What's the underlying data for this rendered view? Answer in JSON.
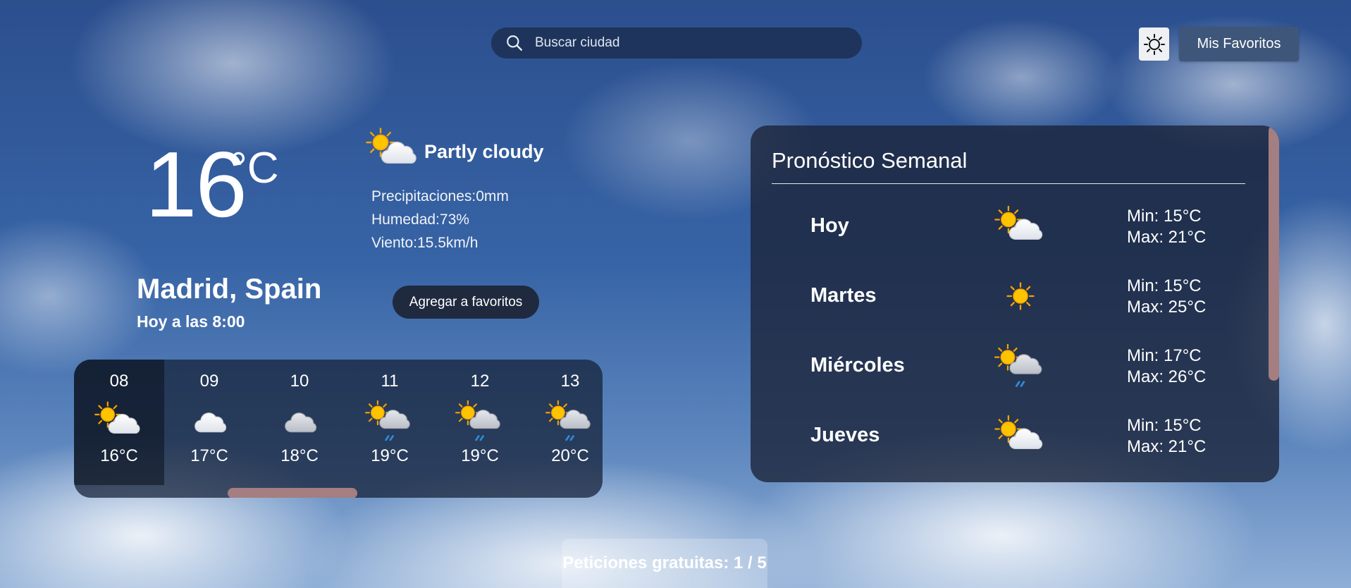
{
  "search": {
    "placeholder": "Buscar ciudad"
  },
  "header": {
    "theme_toggle_icon": "sun-icon",
    "favorites_label": "Mis Favoritos"
  },
  "current": {
    "temperature": "16",
    "unit": "°C",
    "condition": "Partly cloudy",
    "condition_icon": "partly-cloudy-icon",
    "precipitation": "Precipitaciones:0mm",
    "humidity": "Humedad:73%",
    "wind": "Viento:15.5km/h",
    "city": "Madrid, Spain",
    "date": "Hoy a las 8:00",
    "add_favorite_label": "Agregar a favoritos"
  },
  "hourly": [
    {
      "hour": "08",
      "icon": "partly-cloudy-icon",
      "temp": "16°C",
      "active": true
    },
    {
      "hour": "09",
      "icon": "cloud-icon",
      "temp": "17°C"
    },
    {
      "hour": "10",
      "icon": "overcast-icon",
      "temp": "18°C"
    },
    {
      "hour": "11",
      "icon": "patchy-rain-icon",
      "temp": "19°C"
    },
    {
      "hour": "12",
      "icon": "patchy-rain-icon",
      "temp": "19°C"
    },
    {
      "hour": "13",
      "icon": "patchy-rain-icon",
      "temp": "20°C"
    }
  ],
  "weekly": {
    "title": "Pronóstico Semanal",
    "days": [
      {
        "name": "Hoy",
        "icon": "partly-cloudy-icon",
        "min": "Min: 15°C",
        "max": "Max: 21°C"
      },
      {
        "name": "Martes",
        "icon": "sun-icon",
        "min": "Min: 15°C",
        "max": "Max: 25°C"
      },
      {
        "name": "Miércoles",
        "icon": "patchy-rain-icon",
        "min": "Min: 17°C",
        "max": "Max: 26°C"
      },
      {
        "name": "Jueves",
        "icon": "partly-cloudy-icon",
        "min": "Min: 15°C",
        "max": "Max: 21°C"
      }
    ]
  },
  "quota": "Peticiones gratuitas: 1 / 5",
  "colors": {
    "panel": "#1c243a",
    "scroll_thumb": "#a47e80",
    "sun": "#f5b400"
  }
}
